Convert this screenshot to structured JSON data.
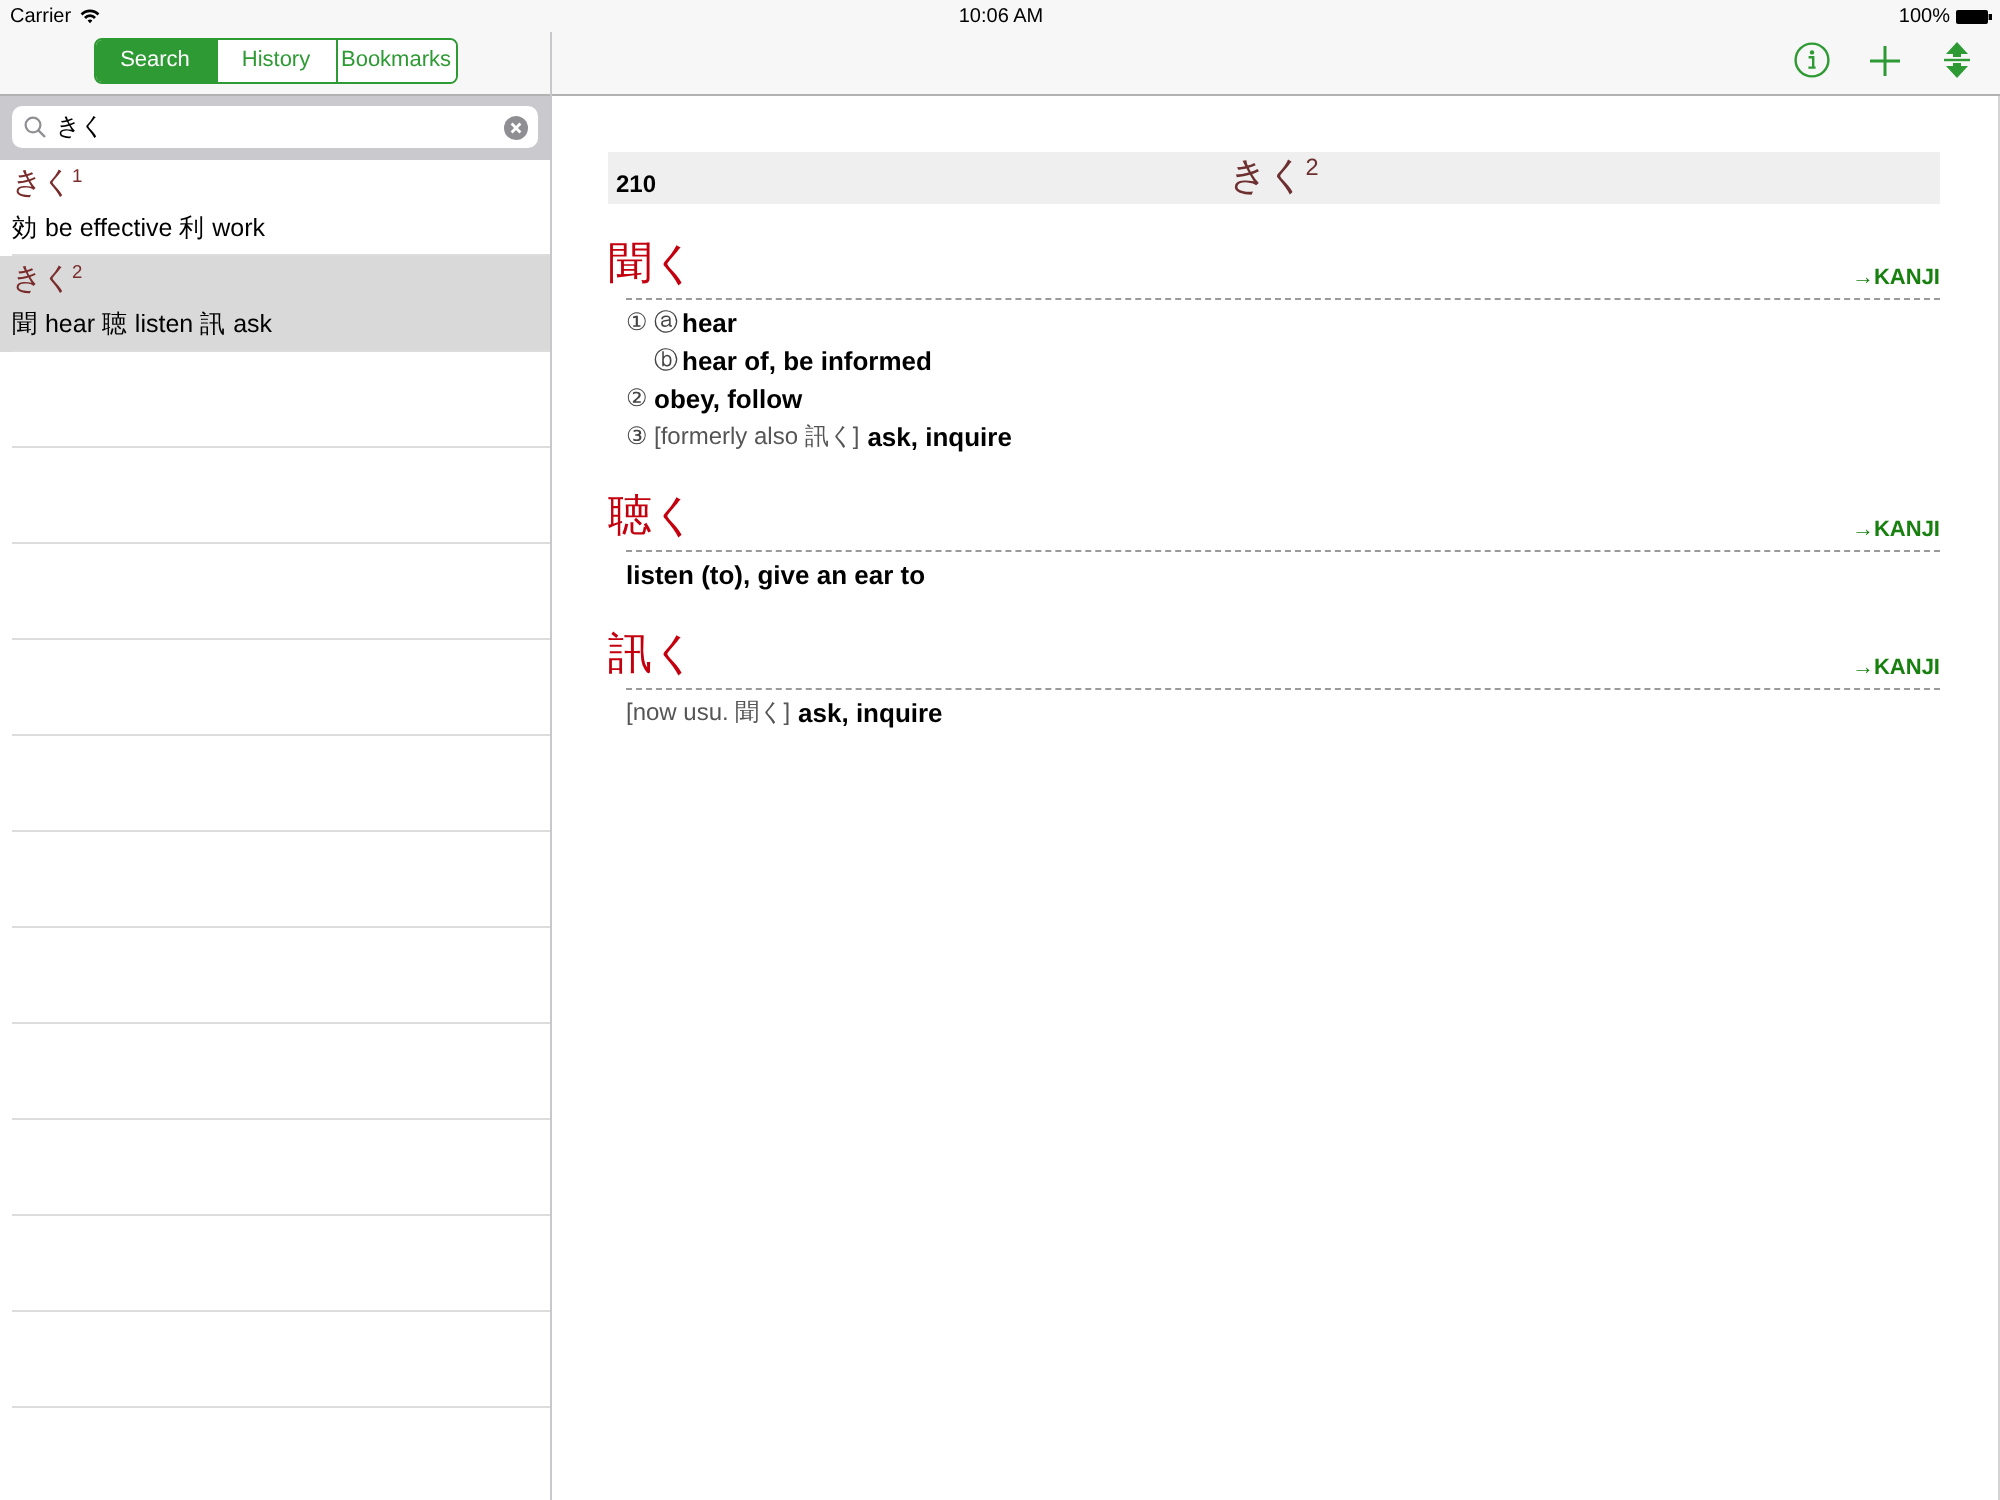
{
  "status_bar": {
    "carrier": "Carrier",
    "time": "10:06 AM",
    "battery": "100%"
  },
  "tabs": [
    {
      "label": "Search",
      "selected": true
    },
    {
      "label": "History",
      "selected": false
    },
    {
      "label": "Bookmarks",
      "selected": false
    }
  ],
  "search": {
    "value": "きく"
  },
  "results": [
    {
      "reading": "きく$^{1}$",
      "gloss": "効 be effective 利 work",
      "selected": false
    },
    {
      "reading": "きく$^{2}$",
      "gloss": "聞 hear 聴 listen 訊 ask",
      "selected": true
    }
  ],
  "entry": {
    "page": "210",
    "heading": "きく$^{2}$",
    "headwords": [
      {
        "headword": "聞く",
        "link": "→KANJI",
        "senses": [
          {
            "number": "①",
            "subsenses": [
              {
                "mark": "ⓐ",
                "gloss": "hear"
              },
              {
                "mark": "ⓑ",
                "gloss": "hear of, be informed"
              }
            ]
          },
          {
            "number": "②",
            "gloss": "obey, follow"
          },
          {
            "number": "③",
            "note": "[formerly also 訊く]",
            "gloss": "ask, inquire"
          }
        ]
      },
      {
        "headword": "聴く",
        "link": "→KANJI",
        "senses": [
          {
            "gloss": "listen (to), give an ear to"
          }
        ]
      },
      {
        "headword": "訊く",
        "link": "→KANJI",
        "senses": [
          {
            "note": "[now usu. 聞く]",
            "gloss": "ask, inquire"
          }
        ]
      }
    ]
  }
}
